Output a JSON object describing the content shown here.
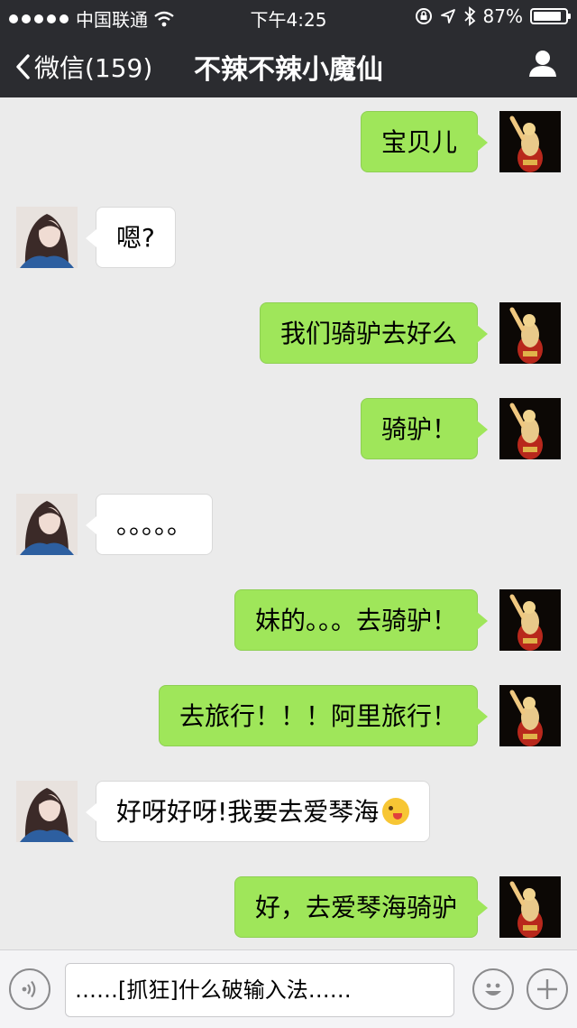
{
  "status_bar": {
    "carrier": "中国联通",
    "time": "下午4:25",
    "battery_percent": "87%",
    "battery_level": 0.87,
    "icons": [
      "signal-dots",
      "wifi-icon",
      "lock-rotation-icon",
      "location-icon",
      "bluetooth-icon",
      "battery-icon"
    ]
  },
  "nav": {
    "back_label": "微信(159)",
    "title": "不辣不辣小魔仙",
    "icons": [
      "chevron-left-icon",
      "person-icon"
    ]
  },
  "messages": [
    {
      "from": "me",
      "text": "宝贝儿"
    },
    {
      "from": "her",
      "text": "嗯?"
    },
    {
      "from": "me",
      "text": "我们骑驴去好么"
    },
    {
      "from": "me",
      "text": "骑驴！"
    },
    {
      "from": "her",
      "text": "。。。。。"
    },
    {
      "from": "me",
      "text": "妹的。。。去骑驴！"
    },
    {
      "from": "me",
      "text": "去旅行！！！阿里旅行！"
    },
    {
      "from": "her",
      "text": "好呀好呀!我要去爱琴海",
      "emoji": "tongue-out-wink-emoji"
    },
    {
      "from": "me",
      "text": "好，去爱琴海骑驴"
    }
  ],
  "input_bar": {
    "value": "……[抓狂]什么破输入法……",
    "icons": [
      "voice-icon",
      "emoji-icon",
      "plus-icon"
    ]
  },
  "colors": {
    "nav_bg": "#2b2c30",
    "chat_bg": "#ebebeb",
    "my_bubble": "#9fe65a",
    "her_bubble": "#ffffff"
  }
}
